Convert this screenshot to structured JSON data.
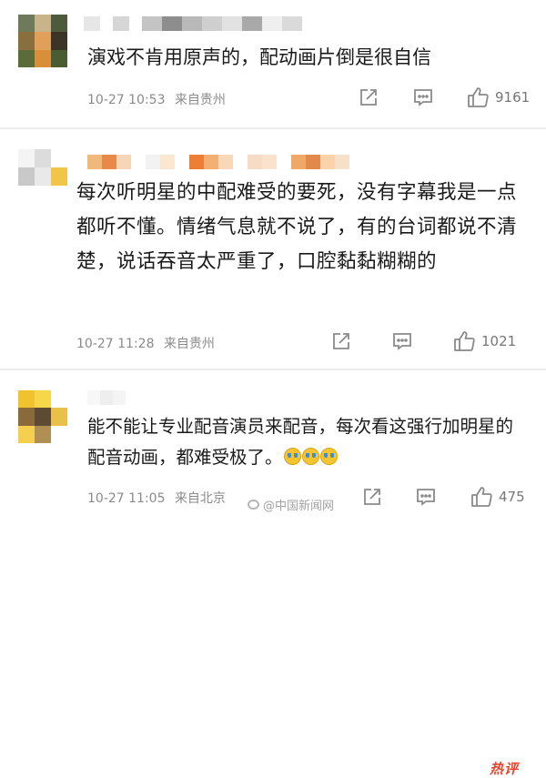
{
  "colors": {
    "accent_hot": "#e8442c",
    "meta_text": "#8a8a8a",
    "divider": "#ececec"
  },
  "comments": [
    {
      "text": "演戏不肯用原声的，配动画片倒是很自信",
      "time": "10-27 10:53",
      "location": "来自贵州",
      "likes": "9161",
      "icons": {
        "repost": "repost-icon",
        "comment": "comment-icon",
        "like": "thumbs-up-icon"
      }
    },
    {
      "text": "每次听明星的中配难受的要死，没有字幕我是一点都听不懂。情绪气息就不说了，有的台词都说不清楚，说话吞音太严重了，口腔黏黏糊糊的",
      "time": "10-27 11:28",
      "location": "来自贵州",
      "likes": "1021",
      "icons": {
        "repost": "repost-icon",
        "comment": "comment-icon",
        "like": "thumbs-up-icon"
      }
    },
    {
      "badge": "热评",
      "text": "能不能让专业配音演员来配音，每次看这强行加明星的配音动画，都难受极了。",
      "emoji": "crying-face-emoji x3",
      "time": "10-27 11:05",
      "location": "来自北京",
      "likes": "475",
      "icons": {
        "repost": "repost-icon",
        "comment": "comment-icon",
        "like": "thumbs-up-icon"
      }
    }
  ],
  "watermark": "@中国新闻网"
}
